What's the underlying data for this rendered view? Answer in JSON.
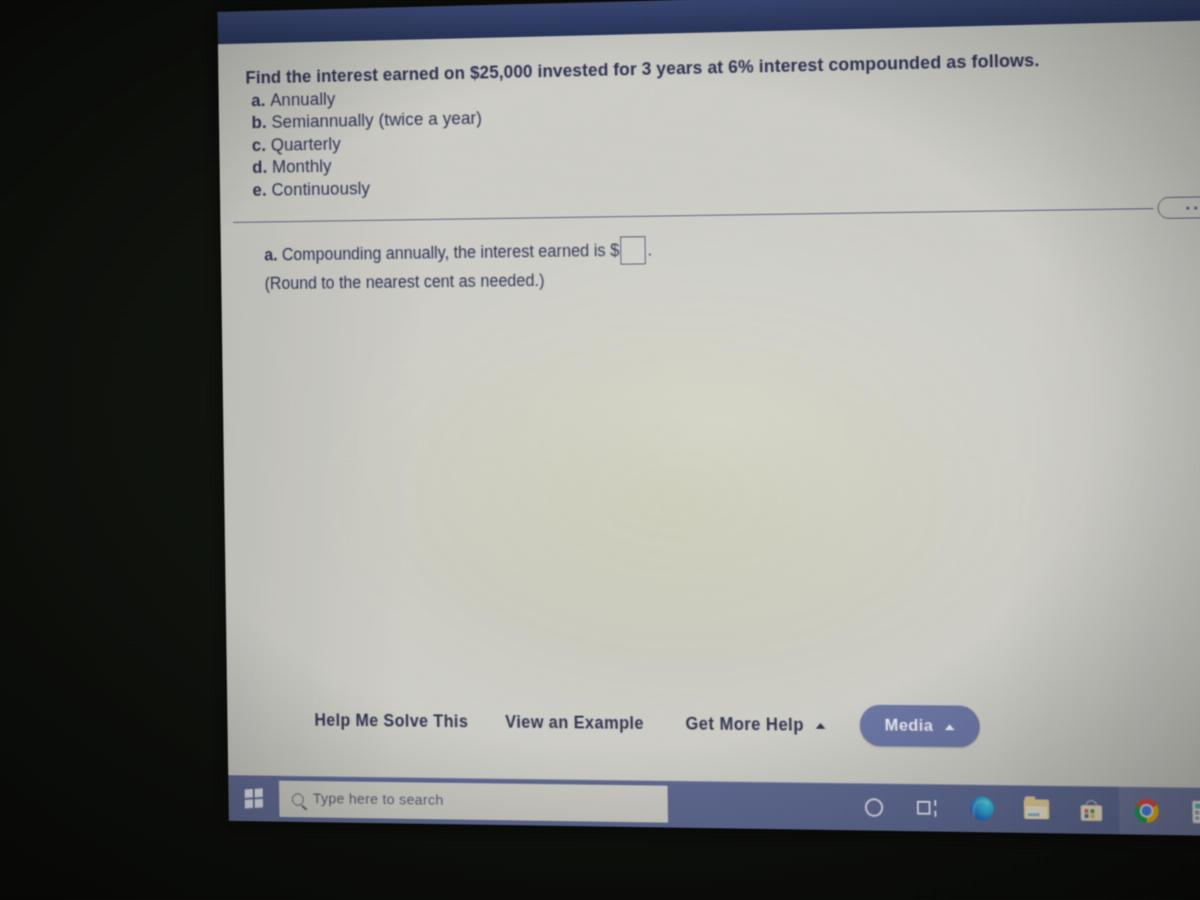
{
  "app": {
    "header_color": "#2e3f73",
    "content_bg": "#d4d4cd",
    "text_color": "#2b2f52"
  },
  "question": {
    "stem": "Find the interest earned on $25,000 invested for 3 years at 6% interest compounded as follows.",
    "principal": "$25,000",
    "years": "3",
    "rate": "6%",
    "options": [
      {
        "label": "a.",
        "text": "Annually"
      },
      {
        "label": "b.",
        "text": "Semiannually (twice a year)"
      },
      {
        "label": "c.",
        "text": "Quarterly"
      },
      {
        "label": "d.",
        "text": "Monthly"
      },
      {
        "label": "e.",
        "text": "Continuously"
      }
    ]
  },
  "divider": {
    "handle_dots": 5
  },
  "answer": {
    "part_label": "a.",
    "prompt_before": "Compounding annually, the interest earned is",
    "currency_symbol": "$",
    "input_value": "",
    "input_placeholder": "",
    "period": ".",
    "hint": "(Round to the nearest cent as needed.)"
  },
  "toolbar": {
    "help_me_solve_this": "Help Me Solve This",
    "view_an_example": "View an Example",
    "get_more_help": "Get More Help",
    "get_more_help_caret": "caret-up-icon",
    "media_label": "Media",
    "media_caret": "caret-up-icon",
    "media_bg": "#6d78a9"
  },
  "taskbar": {
    "bg_color": "#5f6a96",
    "start_icon": "windows-logo-icon",
    "search_placeholder": "Type here to search",
    "search_value": "",
    "search_icon": "search-icon",
    "tray_icons": [
      {
        "name": "cortana-icon"
      },
      {
        "name": "task-view-icon"
      },
      {
        "name": "microsoft-edge-icon"
      },
      {
        "name": "file-explorer-icon"
      },
      {
        "name": "microsoft-store-icon"
      },
      {
        "name": "google-chrome-icon"
      },
      {
        "name": "calculator-icon"
      }
    ]
  }
}
